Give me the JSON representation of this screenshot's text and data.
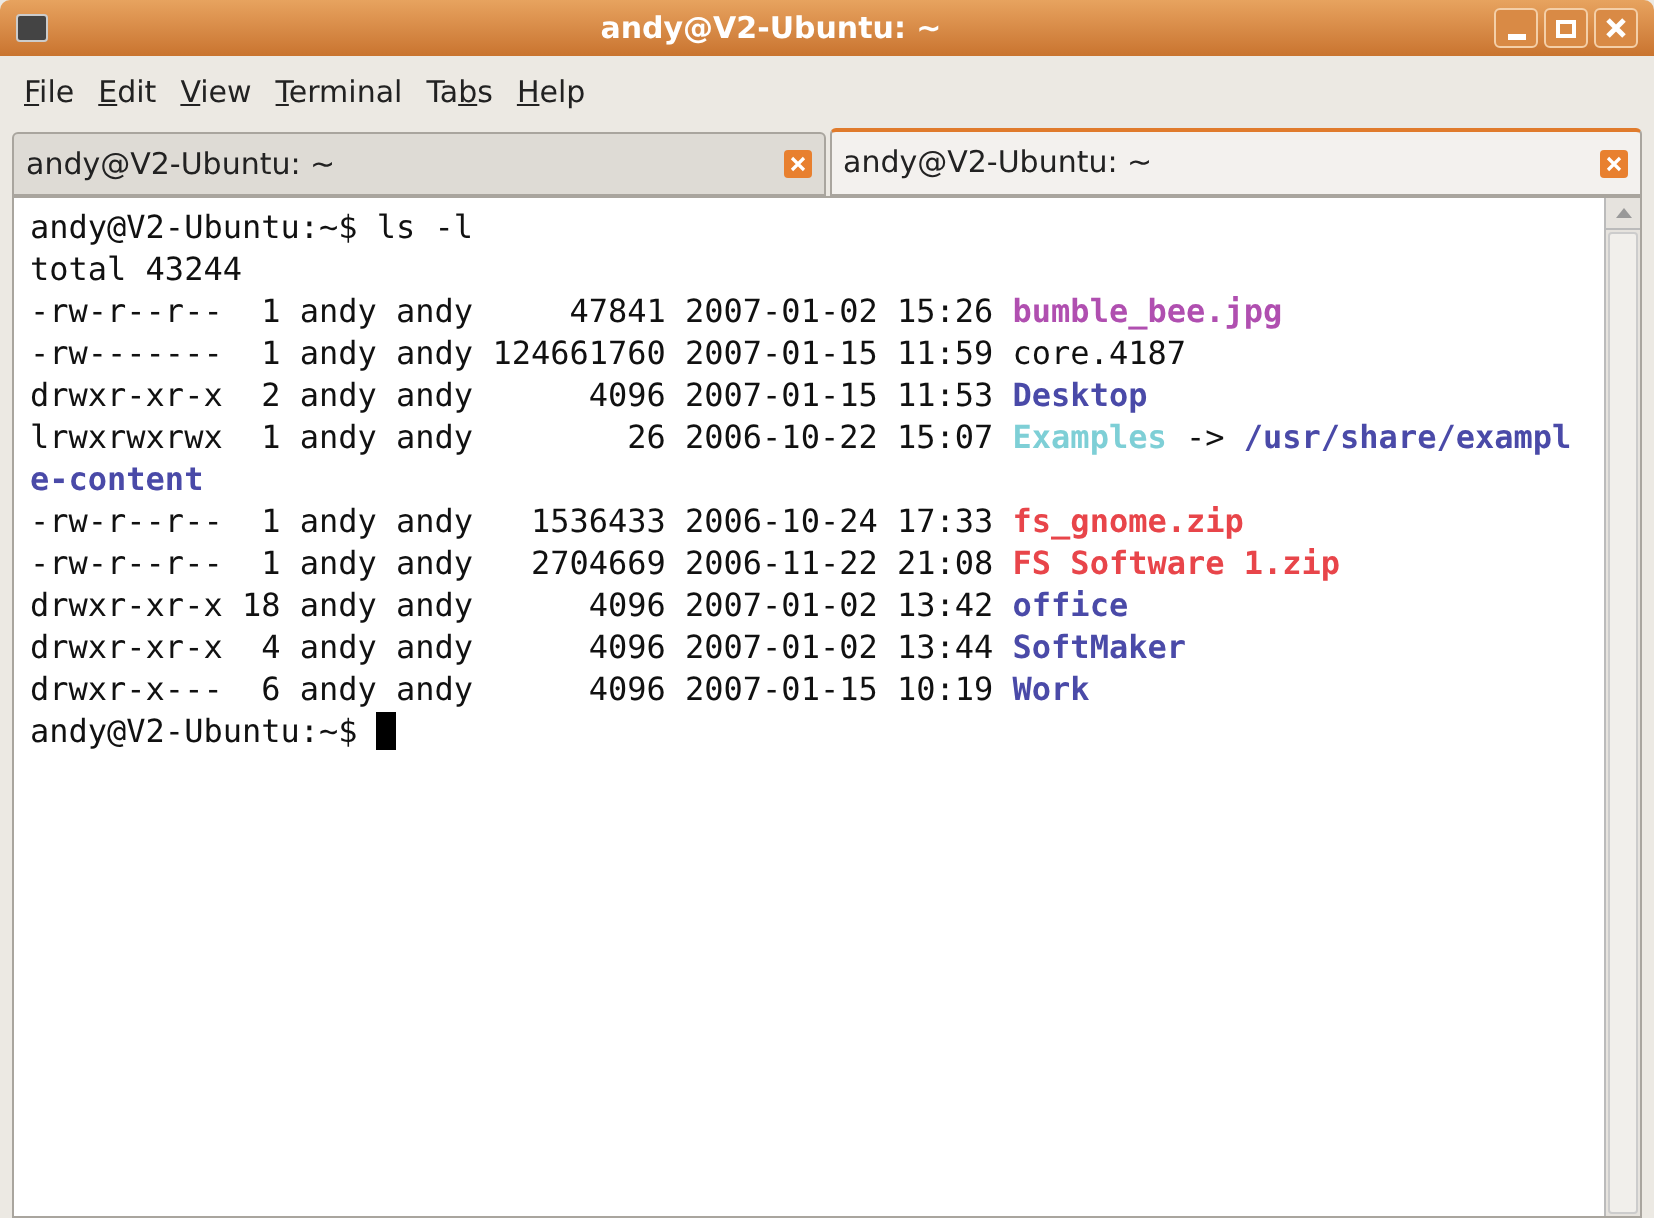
{
  "window": {
    "title": "andy@V2-Ubuntu: ~"
  },
  "menu": [
    {
      "mnemonic": "F",
      "rest": "ile"
    },
    {
      "mnemonic": "E",
      "rest": "dit"
    },
    {
      "mnemonic": "V",
      "rest": "iew"
    },
    {
      "mnemonic": "T",
      "rest": "erminal"
    },
    {
      "lead": "Ta",
      "mnemonic": "b",
      "rest": "s"
    },
    {
      "mnemonic": "H",
      "rest": "elp"
    }
  ],
  "tabs": [
    {
      "label": "andy@V2-Ubuntu: ~",
      "selected": false
    },
    {
      "label": "andy@V2-Ubuntu: ~",
      "selected": true
    }
  ],
  "terminal": {
    "lines": [
      [
        {
          "text": "andy@V2-Ubuntu:~$ ls -l",
          "kind": "plain"
        }
      ],
      [
        {
          "text": "total 43244",
          "kind": "plain"
        }
      ],
      [
        {
          "text": "-rw-r--r--  1 andy andy     47841 2007-01-02 15:26 ",
          "kind": "plain"
        },
        {
          "text": "bumble_bee.jpg",
          "kind": "image"
        }
      ],
      [
        {
          "text": "-rw-------  1 andy andy 124661760 2007-01-15 11:59 core.4187",
          "kind": "plain"
        }
      ],
      [
        {
          "text": "drwxr-xr-x  2 andy andy      4096 2007-01-15 11:53 ",
          "kind": "plain"
        },
        {
          "text": "Desktop",
          "kind": "directory"
        }
      ],
      [
        {
          "text": "lrwxrwxrwx  1 andy andy        26 2006-10-22 15:07 ",
          "kind": "plain"
        },
        {
          "text": "Examples",
          "kind": "symlink"
        },
        {
          "text": " -> ",
          "kind": "plain"
        },
        {
          "text": "/usr/share/exampl",
          "kind": "directory"
        }
      ],
      [
        {
          "text": "e-content",
          "kind": "directory"
        }
      ],
      [
        {
          "text": "-rw-r--r--  1 andy andy   1536433 2006-10-24 17:33 ",
          "kind": "plain"
        },
        {
          "text": "fs_gnome.zip",
          "kind": "archive"
        }
      ],
      [
        {
          "text": "-rw-r--r--  1 andy andy   2704669 2006-11-22 21:08 ",
          "kind": "plain"
        },
        {
          "text": "FS Software 1.zip",
          "kind": "archive"
        }
      ],
      [
        {
          "text": "drwxr-xr-x 18 andy andy      4096 2007-01-02 13:42 ",
          "kind": "plain"
        },
        {
          "text": "office",
          "kind": "directory"
        }
      ],
      [
        {
          "text": "drwxr-xr-x  4 andy andy      4096 2007-01-02 13:44 ",
          "kind": "plain"
        },
        {
          "text": "SoftMaker",
          "kind": "directory"
        }
      ],
      [
        {
          "text": "drwxr-x---  6 andy andy      4096 2007-01-15 10:19 ",
          "kind": "plain"
        },
        {
          "text": "Work",
          "kind": "directory"
        }
      ],
      [
        {
          "text": "andy@V2-Ubuntu:~$ ",
          "kind": "plain"
        },
        {
          "kind": "cursor"
        }
      ]
    ]
  }
}
